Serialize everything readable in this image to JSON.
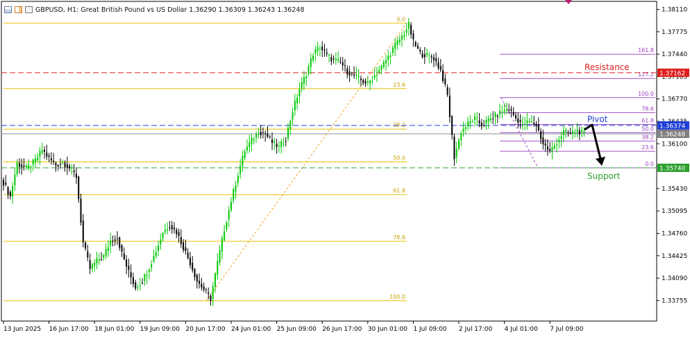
{
  "header": {
    "symbol_line": "GBPUSD, H1:  Great British Pound vs US Dollar  1.36290 1.36309 1.36243 1.36248"
  },
  "chart_data": {
    "type": "candlestick",
    "symbol": "GBPUSD",
    "timeframe": "H1",
    "ylim": [
      1.3352,
      1.3828
    ],
    "y_ticks": [
      "1.38110",
      "1.37775",
      "1.37440",
      "1.37105",
      "1.36770",
      "1.36435",
      "1.36100",
      "1.35765",
      "1.35430",
      "1.35095",
      "1.34760",
      "1.34425",
      "1.34090",
      "1.33755"
    ],
    "x_ticks": [
      {
        "label": "13 Jun 2025",
        "bar": 0
      },
      {
        "label": "16 Jun 17:00",
        "bar": 20
      },
      {
        "label": "18 Jun 01:00",
        "bar": 40
      },
      {
        "label": "19 Jun 09:00",
        "bar": 60
      },
      {
        "label": "20 Jun 17:00",
        "bar": 80
      },
      {
        "label": "24 Jun 01:00",
        "bar": 100
      },
      {
        "label": "25 Jun 09:00",
        "bar": 120
      },
      {
        "label": "26 Jun 17:00",
        "bar": 140
      },
      {
        "label": "30 Jun 01:00",
        "bar": 160
      },
      {
        "label": "1 Jul 09:00",
        "bar": 180
      },
      {
        "label": "2 Jul 17:00",
        "bar": 200
      },
      {
        "label": "4 Jul 01:00",
        "bar": 220
      },
      {
        "label": "7 Jul 09:00",
        "bar": 240
      }
    ],
    "bars_visible": 256,
    "close_anchors": [
      [
        0,
        1.3552
      ],
      [
        3,
        1.3531
      ],
      [
        6,
        1.3581
      ],
      [
        10,
        1.3573
      ],
      [
        14,
        1.3585
      ],
      [
        17,
        1.3601
      ],
      [
        20,
        1.3588
      ],
      [
        23,
        1.3578
      ],
      [
        26,
        1.3582
      ],
      [
        29,
        1.3574
      ],
      [
        32,
        1.3561
      ],
      [
        35,
        1.3462
      ],
      [
        38,
        1.3423
      ],
      [
        41,
        1.3435
      ],
      [
        44,
        1.3442
      ],
      [
        47,
        1.3465
      ],
      [
        50,
        1.347
      ],
      [
        52,
        1.3446
      ],
      [
        55,
        1.3418
      ],
      [
        58,
        1.3395
      ],
      [
        61,
        1.3405
      ],
      [
        64,
        1.3425
      ],
      [
        67,
        1.345
      ],
      [
        70,
        1.3478
      ],
      [
        73,
        1.3488
      ],
      [
        76,
        1.3478
      ],
      [
        79,
        1.3455
      ],
      [
        82,
        1.3432
      ],
      [
        85,
        1.3405
      ],
      [
        88,
        1.3392
      ],
      [
        91,
        1.3378
      ],
      [
        94,
        1.3432
      ],
      [
        97,
        1.3482
      ],
      [
        100,
        1.3525
      ],
      [
        103,
        1.3565
      ],
      [
        106,
        1.36
      ],
      [
        109,
        1.3615
      ],
      [
        112,
        1.3628
      ],
      [
        115,
        1.3625
      ],
      [
        118,
        1.3612
      ],
      [
        121,
        1.3605
      ],
      [
        124,
        1.3618
      ],
      [
        127,
        1.366
      ],
      [
        130,
        1.3692
      ],
      [
        133,
        1.3715
      ],
      [
        136,
        1.3745
      ],
      [
        139,
        1.3755
      ],
      [
        142,
        1.3742
      ],
      [
        145,
        1.3735
      ],
      [
        148,
        1.3732
      ],
      [
        151,
        1.3718
      ],
      [
        154,
        1.3712
      ],
      [
        157,
        1.3705
      ],
      [
        160,
        1.37
      ],
      [
        163,
        1.3712
      ],
      [
        166,
        1.3725
      ],
      [
        169,
        1.374
      ],
      [
        172,
        1.3758
      ],
      [
        175,
        1.377
      ],
      [
        178,
        1.3788
      ],
      [
        180,
        1.3762
      ],
      [
        183,
        1.3745
      ],
      [
        186,
        1.3742
      ],
      [
        189,
        1.3738
      ],
      [
        192,
        1.372
      ],
      [
        195,
        1.3682
      ],
      [
        198,
        1.359
      ],
      [
        201,
        1.3628
      ],
      [
        204,
        1.364
      ],
      [
        207,
        1.3648
      ],
      [
        210,
        1.3638
      ],
      [
        213,
        1.3645
      ],
      [
        216,
        1.3652
      ],
      [
        219,
        1.3658
      ],
      [
        222,
        1.3662
      ],
      [
        225,
        1.3648
      ],
      [
        228,
        1.364
      ],
      [
        231,
        1.3643
      ],
      [
        234,
        1.3638
      ],
      [
        237,
        1.361
      ],
      [
        240,
        1.3598
      ],
      [
        243,
        1.3612
      ],
      [
        246,
        1.3628
      ],
      [
        249,
        1.3625
      ],
      [
        252,
        1.363
      ],
      [
        255,
        1.36248
      ]
    ],
    "fib_retracement_main": {
      "low": 1.33752,
      "high": 1.37905,
      "x_start_bar": 0,
      "x_end_bar": 178,
      "levels": [
        {
          "label": "0.0",
          "ratio": 0.0
        },
        {
          "label": "23.6",
          "ratio": 0.236
        },
        {
          "label": "38.2",
          "ratio": 0.382
        },
        {
          "label": "50.0",
          "ratio": 0.5
        },
        {
          "label": "61.8",
          "ratio": 0.618
        },
        {
          "label": "78.6",
          "ratio": 0.786
        },
        {
          "label": "100.0",
          "ratio": 1.0
        }
      ]
    },
    "fib_extension_small": {
      "price_0": 1.3574,
      "price_100": 1.3679,
      "x_start_bar": 220,
      "x_end_bar": 256,
      "levels": [
        {
          "label": "0.0",
          "ratio": 0.0
        },
        {
          "label": "23.6",
          "ratio": 0.236
        },
        {
          "label": "38.2",
          "ratio": 0.382
        },
        {
          "label": "50.0",
          "ratio": 0.5
        },
        {
          "label": "61.8",
          "ratio": 0.618
        },
        {
          "label": "78.6",
          "ratio": 0.786
        },
        {
          "label": "100.0",
          "ratio": 1.0
        },
        {
          "label": "127.2",
          "ratio": 1.272
        },
        {
          "label": "161.8",
          "ratio": 1.618
        }
      ]
    },
    "horizontal_lines": [
      {
        "name": "Resistance",
        "price": 1.37162,
        "color": "#e02020",
        "price_label": "1.37162"
      },
      {
        "name": "Pivot",
        "price": 1.36374,
        "color": "#1f3fd6",
        "price_label": "1.36374"
      },
      {
        "name": "Support",
        "price": 1.3574,
        "color": "#2ea02e",
        "price_label": "1.35740"
      }
    ],
    "current_price": {
      "price": 1.36248,
      "label": "1.36248"
    },
    "annotations": [
      {
        "text": "Resistance",
        "color": "#e02020"
      },
      {
        "text": "Pivot",
        "color": "#1f3fd6"
      },
      {
        "text": "Support",
        "color": "#2ea02e"
      }
    ],
    "colors": {
      "bull": "#00c800",
      "bear": "#000000",
      "fib_main": "#e8c000",
      "fib_small": "#a050c8",
      "grid": "#b0b0b0"
    }
  }
}
